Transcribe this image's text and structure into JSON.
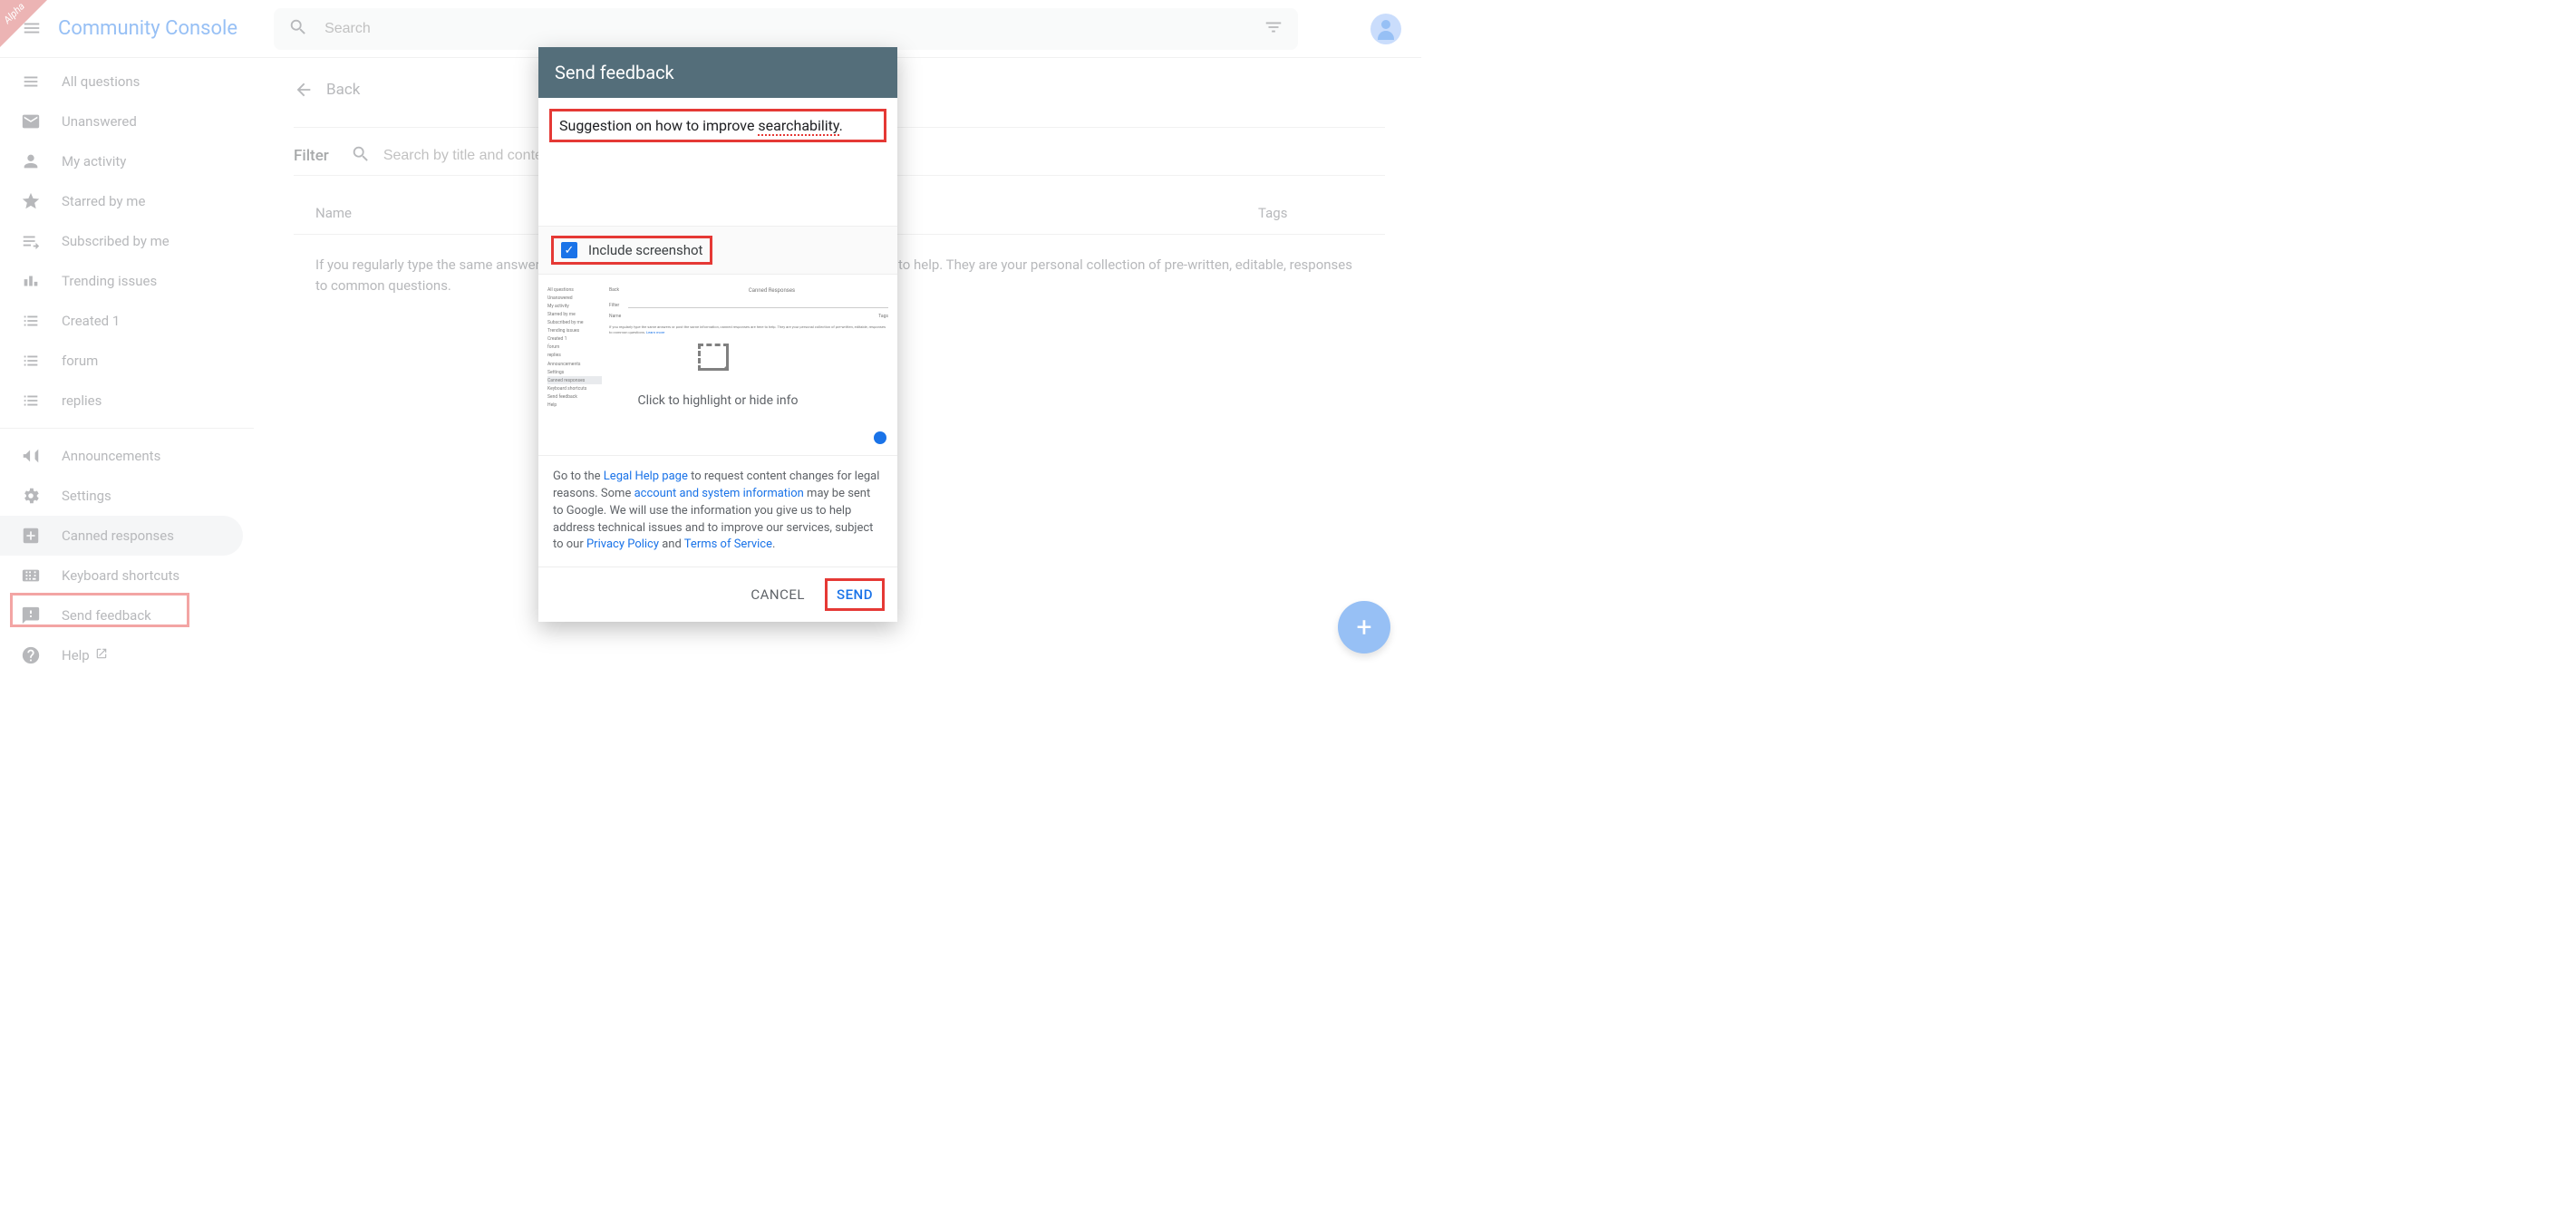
{
  "ribbon": "Alpha",
  "app_title": "Community Console",
  "search_placeholder": "Search",
  "sidebar": {
    "items": [
      {
        "label": "All questions",
        "icon": "list-icon"
      },
      {
        "label": "Unanswered",
        "icon": "mail-unread-icon"
      },
      {
        "label": "My activity",
        "icon": "person-activity-icon"
      },
      {
        "label": "Starred by me",
        "icon": "star-icon"
      },
      {
        "label": "Subscribed by me",
        "icon": "subscriptions-icon"
      },
      {
        "label": "Trending issues",
        "icon": "trending-icon"
      },
      {
        "label": "Created 1",
        "icon": "list-bullet-icon"
      },
      {
        "label": "forum",
        "icon": "list-bullet-icon"
      },
      {
        "label": "replies",
        "icon": "list-bullet-icon"
      }
    ],
    "lower": [
      {
        "label": "Announcements",
        "icon": "megaphone-icon"
      },
      {
        "label": "Settings",
        "icon": "gear-icon"
      },
      {
        "label": "Canned responses",
        "icon": "add-box-icon",
        "selected": true
      },
      {
        "label": "Keyboard shortcuts",
        "icon": "keyboard-icon"
      },
      {
        "label": "Send feedback",
        "icon": "feedback-icon",
        "highlighted": true
      },
      {
        "label": "Help",
        "icon": "help-icon",
        "ext": true
      }
    ]
  },
  "main": {
    "back_label": "Back",
    "filter_label": "Filter",
    "filter_placeholder": "Search by title and content",
    "col_name": "Name",
    "col_tags": "Tags",
    "body_text": "If you regularly type the same answers or post the same information, canned responses are here to help. They are your personal collection of pre-written, editable, responses to common questions."
  },
  "dialog": {
    "title": "Send feedback",
    "input_text_prefix": "Suggestion on how to improve ",
    "input_text_word": "searchability",
    "input_text_suffix": ".",
    "include_screenshot_label": "Include screenshot",
    "include_screenshot_checked": true,
    "preview_hint": "Click to highlight or hide info",
    "preview_title": "Canned Responses",
    "preview_back": "Back",
    "preview_filter": "Filter",
    "preview_name": "Name",
    "preview_tags": "Tags",
    "preview_side": [
      "All questions",
      "Unanswered",
      "My activity",
      "Starred by me",
      "Subscribed by me",
      "Trending issues",
      "Created 1",
      "forum",
      "replies",
      "",
      "Announcements",
      "Settings",
      "Canned responses",
      "Keyboard shortcuts",
      "Send feedback",
      "Help"
    ],
    "legal_prefix": "Go to the ",
    "legal_link1": "Legal Help page",
    "legal_mid1": " to request content changes for legal reasons. Some ",
    "legal_link2": "account and system information",
    "legal_mid2": " may be sent to Google. We will use the information you give us to help address technical issues and to improve our services, subject to our ",
    "legal_link3": "Privacy Policy",
    "legal_and": " and ",
    "legal_link4": "Terms of Service",
    "legal_end": ".",
    "cancel": "CANCEL",
    "send": "SEND"
  }
}
